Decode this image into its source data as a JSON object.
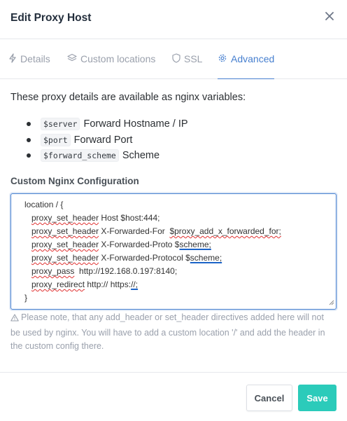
{
  "modal": {
    "title": "Edit Proxy Host",
    "close_icon": "close-icon"
  },
  "tabs": [
    {
      "label": "Details",
      "icon": "bolt-icon",
      "active": false
    },
    {
      "label": "Custom locations",
      "icon": "layers-icon",
      "active": false
    },
    {
      "label": "SSL",
      "icon": "shield-icon",
      "active": false
    },
    {
      "label": "Advanced",
      "icon": "gear-icon",
      "active": true
    }
  ],
  "intro": "These proxy details are available as nginx variables:",
  "variables": [
    {
      "code": "$server",
      "desc": "Forward Hostname / IP"
    },
    {
      "code": "$port",
      "desc": "Forward Port"
    },
    {
      "code": "$forward_scheme",
      "desc": "Scheme"
    }
  ],
  "config": {
    "label": "Custom Nginx Configuration",
    "lines": [
      "location / {",
      "proxy_set_header Host $host:444;",
      "proxy_set_header X-Forwarded-For  $proxy_add_x_forwarded_for;",
      "proxy_set_header X-Forwarded-Proto $scheme;",
      "proxy_set_header X-Forwarded-Protocol $scheme;",
      "proxy_pass  http://192.168.0.197:8140;",
      "proxy_redirect http:// https://;",
      "}"
    ]
  },
  "note": "Please note, that any add_header or set_header directives added here will not be used by nginx. You will have to add a custom location '/' and add the header in the custom config there.",
  "footer": {
    "cancel_label": "Cancel",
    "save_label": "Save"
  },
  "colors": {
    "accent": "#467fcf",
    "save_button": "#2bcbba",
    "muted_text": "#9aa0ac"
  }
}
